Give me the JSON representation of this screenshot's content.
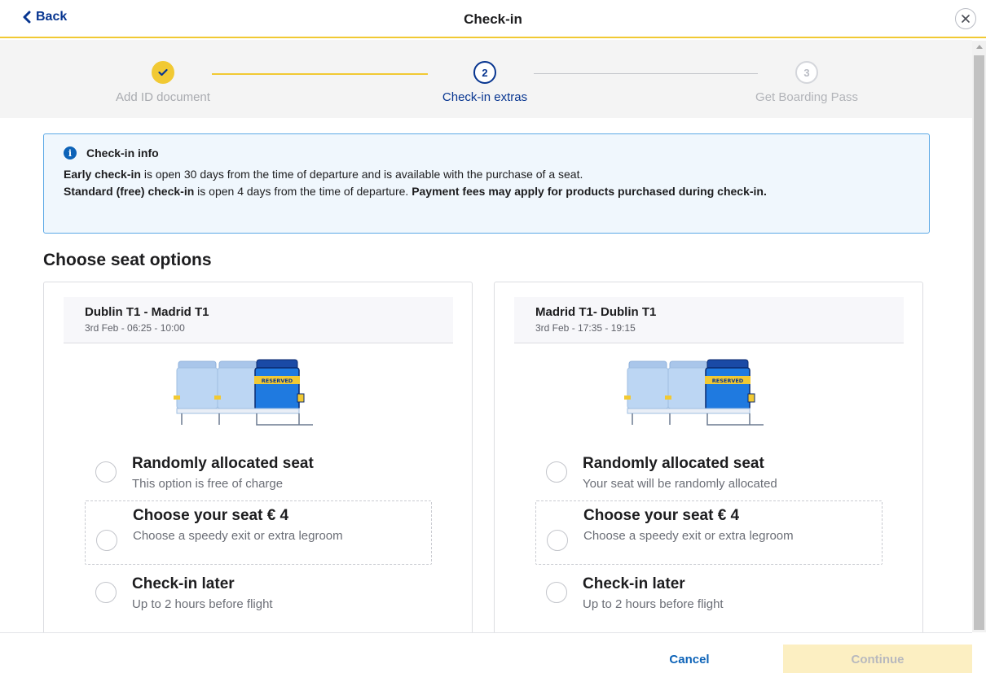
{
  "header": {
    "back_label": "Back",
    "title": "Check-in",
    "close_icon": "close-icon"
  },
  "stepper": {
    "steps": [
      {
        "number": "1",
        "label": "Add ID document",
        "state": "done"
      },
      {
        "number": "2",
        "label": "Check-in extras",
        "state": "current"
      },
      {
        "number": "3",
        "label": "Get Boarding Pass",
        "state": "future"
      }
    ]
  },
  "info": {
    "title": "Check-in info",
    "icon": "i",
    "early_bold": "Early check-in",
    "early_rest": " is open 30 days from the time of departure and is available with the purchase of a seat.",
    "standard_bold": "Standard (free) check-in",
    "standard_rest": " is open 4 days from the time of departure. ",
    "fees_bold": "Payment fees may apply for products purchased during check-in."
  },
  "section_title": "Choose seat options",
  "seat_tag": "RESERVED",
  "flights": [
    {
      "route": "Dublin T1 - Madrid T1",
      "time": "3rd Feb - 06:25 - 10:00",
      "options": [
        {
          "title": "Randomly allocated seat",
          "desc": "This option is free of charge"
        },
        {
          "title": "Choose your seat € 4",
          "desc": "Choose a speedy exit or extra legroom"
        },
        {
          "title": "Check-in later",
          "desc": "Up to 2 hours before flight"
        }
      ]
    },
    {
      "route": "Madrid T1- Dublin T1",
      "time": "3rd Feb - 17:35 - 19:15",
      "options": [
        {
          "title": "Randomly allocated seat",
          "desc": "Your seat will be randomly allocated"
        },
        {
          "title": "Choose your seat € 4",
          "desc": "Choose a speedy exit or extra legroom"
        },
        {
          "title": "Check-in later",
          "desc": "Up to 2 hours before flight"
        }
      ]
    }
  ],
  "footer": {
    "cancel_label": "Cancel",
    "continue_label": "Continue"
  },
  "colors": {
    "brand_blue": "#073590",
    "accent_yellow": "#f1c933",
    "info_border": "#5ca9e6",
    "link_blue": "#0d63b8",
    "continue_disabled": "#fcefc2"
  }
}
